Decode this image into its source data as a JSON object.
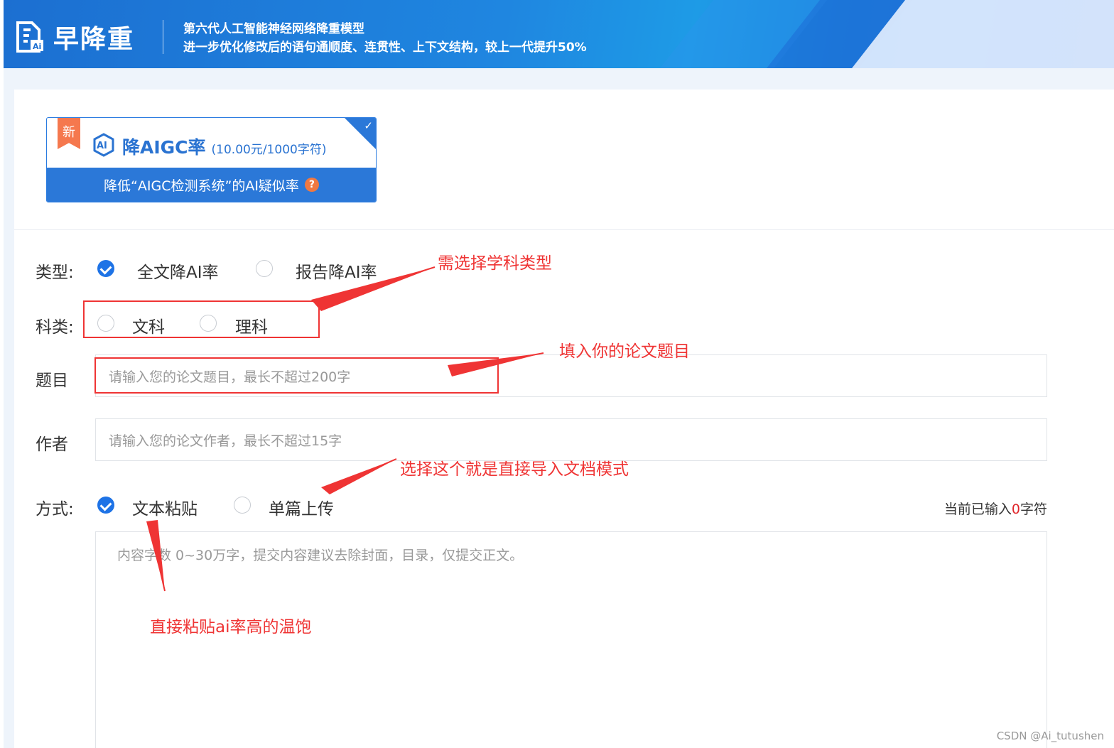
{
  "header": {
    "brand": "早降重",
    "logo_badge": "Ai",
    "slogan_line1": "第六代人工智能神经网络降重模型",
    "slogan_line2": "进一步优化修改后的语句通顺度、连贯性、上下文结构，较上一代提升50%"
  },
  "product_card": {
    "badge": "新",
    "icon_label": "AI",
    "name": "降AIGC率",
    "price": "(10.00元/1000字符)",
    "description": "降低“AIGC检测系统”的AI疑似率",
    "help": "?",
    "selected": true
  },
  "form": {
    "type": {
      "label": "类型:",
      "options": [
        "全文降AI率",
        "报告降AI率"
      ],
      "selected": "全文降AI率"
    },
    "subject": {
      "label": "科类:",
      "options": [
        "文科",
        "理科"
      ],
      "selected": null
    },
    "title": {
      "label": "题目",
      "placeholder": "请输入您的论文题目，最长不超过200字"
    },
    "author": {
      "label": "作者",
      "placeholder": "请输入您的论文作者，最长不超过15字"
    },
    "method": {
      "label": "方式:",
      "options": [
        "文本粘贴",
        "单篇上传"
      ],
      "selected": "文本粘贴"
    },
    "char_count": {
      "prefix": "当前已输入",
      "value": "0",
      "suffix": "字符"
    },
    "content": {
      "placeholder": "内容字数 0~30万字，提交内容建议去除封面，目录，仅提交正文。"
    }
  },
  "annotations": {
    "subject_note": "需选择学科类型",
    "title_note": "填入你的论文题目",
    "upload_note": "选择这个就是直接导入文档模式",
    "paste_note": "直接粘贴ai率高的温饱"
  },
  "watermark": "CSDN @Ai_tutushen",
  "colors": {
    "primary": "#1e73e6",
    "header_blue": "#1f86e0",
    "annotation_red": "#ef3434",
    "badge_orange": "#f5784e"
  }
}
